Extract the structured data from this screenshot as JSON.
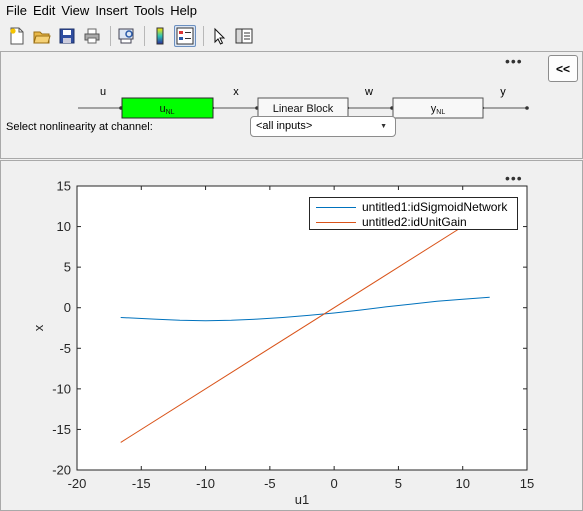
{
  "menubar": [
    "File",
    "Edit",
    "View",
    "Insert",
    "Tools",
    "Help"
  ],
  "toolbar": {
    "icons": [
      "new-figure-icon",
      "open-file-icon",
      "save-icon",
      "print-icon",
      "print-preview-icon",
      "colorbar-icon",
      "legend-icon",
      "select-pointer-icon",
      "property-editor-icon"
    ],
    "pressed": "legend-icon"
  },
  "top_panel": {
    "collapse_label": "<<",
    "diagram": {
      "signals": {
        "u": "u",
        "x": "x",
        "w": "w",
        "y": "y"
      },
      "blocks": {
        "input_nl": {
          "label": "u",
          "sub": "NL",
          "color": "#00ff00"
        },
        "linear": {
          "label": "Linear Block"
        },
        "output_nl": {
          "label": "y",
          "sub": "NL"
        }
      }
    },
    "channel_label": "Select nonlinearity at channel:",
    "channel_value": "<all inputs>"
  },
  "chart_data": {
    "type": "line",
    "xlabel": "u1",
    "ylabel": "x",
    "xlim": [
      -20,
      15
    ],
    "ylim": [
      -20,
      15
    ],
    "xticks": [
      -20,
      -15,
      -10,
      -5,
      0,
      5,
      10,
      15
    ],
    "yticks": [
      -20,
      -15,
      -10,
      -5,
      0,
      5,
      10,
      15
    ],
    "grid": false,
    "legend_placement": "top-right",
    "series": [
      {
        "name": "untitled1:idSigmoidNetwork",
        "color": "#0072bd",
        "x": [
          -16.6,
          -14,
          -12,
          -10,
          -8,
          -6,
          -4,
          -2,
          0,
          2,
          4,
          6,
          8,
          10,
          12.1
        ],
        "y": [
          -1.2,
          -1.4,
          -1.55,
          -1.6,
          -1.55,
          -1.4,
          -1.2,
          -0.95,
          -0.65,
          -0.3,
          0.1,
          0.45,
          0.8,
          1.05,
          1.3
        ]
      },
      {
        "name": "untitled2:idUnitGain",
        "color": "#d95319",
        "x": [
          -16.6,
          12.1
        ],
        "y": [
          -16.6,
          12.1
        ]
      }
    ]
  }
}
